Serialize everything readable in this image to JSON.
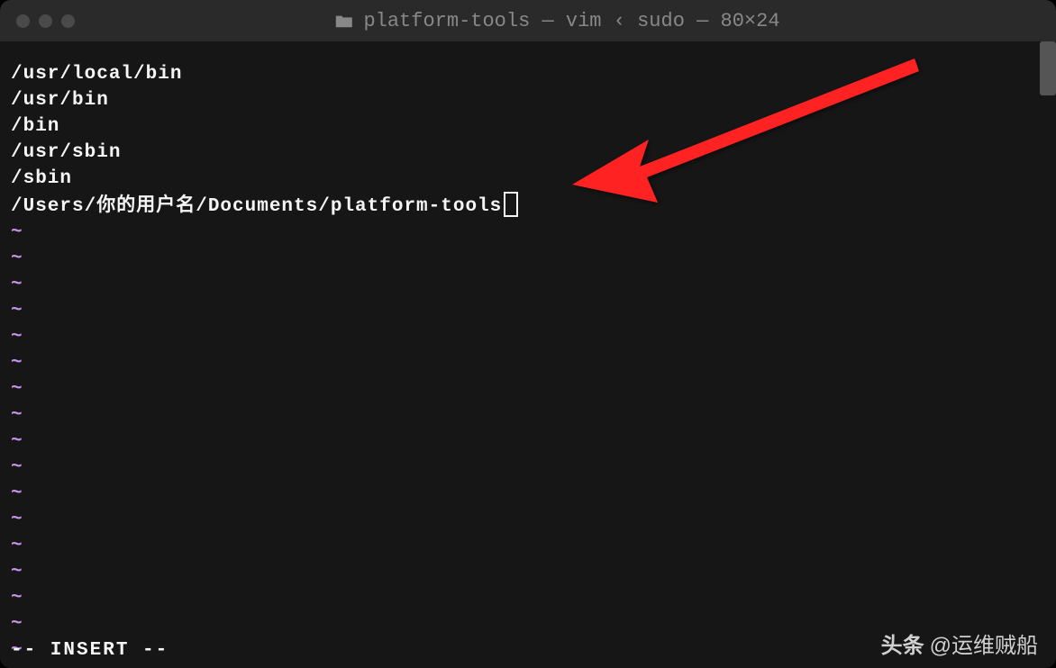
{
  "titlebar": {
    "title": "platform-tools — vim ‹ sudo — 80×24"
  },
  "editor": {
    "lines": [
      "/usr/local/bin",
      "/usr/bin",
      "/bin",
      "/usr/sbin",
      "/sbin",
      "/Users/你的用户名/Documents/platform-tools"
    ],
    "tilde_count": 17,
    "tilde_char": "~",
    "status": "-- INSERT --"
  },
  "watermark": {
    "brand": "头条",
    "user": "@运维贼船"
  }
}
